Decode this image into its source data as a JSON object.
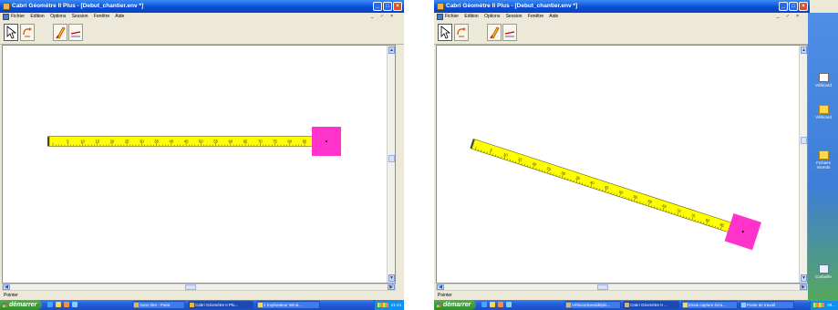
{
  "window": {
    "title": "Cabri Géomètre II Plus - [Debut_chantier.env *]",
    "menu": [
      "Fichier",
      "Edition",
      "Options",
      "Session",
      "Fenêtre",
      "Aide"
    ],
    "mdi_controls": "_ ♂ ×"
  },
  "ruler": {
    "tick_labels": [
      "5",
      "10",
      "15",
      "20",
      "25",
      "30",
      "35",
      "40",
      "45",
      "50",
      "55",
      "60",
      "65",
      "70",
      "75",
      "80",
      "85"
    ],
    "color": "#ffff00",
    "square_color": "#ff33cc"
  },
  "status": {
    "text": "Pointer"
  },
  "taskbar_left": {
    "start_label": "démarrer",
    "tasks": [
      "Sans titre - Paint",
      "Cabri Géomètre II Plu...",
      "2 Explorateur Wind..."
    ],
    "clock": "21:44"
  },
  "taskbar_right": {
    "start_label": "démarrer",
    "tasks": [
      "Véhicardcanddéplo...",
      "Cabri Géomètre II ...",
      "Essai capture écra...",
      "Poste de travail"
    ],
    "clock": "09..."
  },
  "desktop_icons": [
    {
      "label": "Véhicard",
      "icon": "document-icon"
    },
    {
      "label": "Véhicard",
      "icon": "folder-icon"
    },
    {
      "label": "Fichiers récents",
      "icon": "folder-icon"
    },
    {
      "label": "Corbeille",
      "icon": "recycle-bin-icon"
    }
  ],
  "colors": {
    "titlebar": "#0a4fd6",
    "taskbar": "#245edb",
    "start_button": "#2f8e2c",
    "chrome": "#ece9d8"
  }
}
